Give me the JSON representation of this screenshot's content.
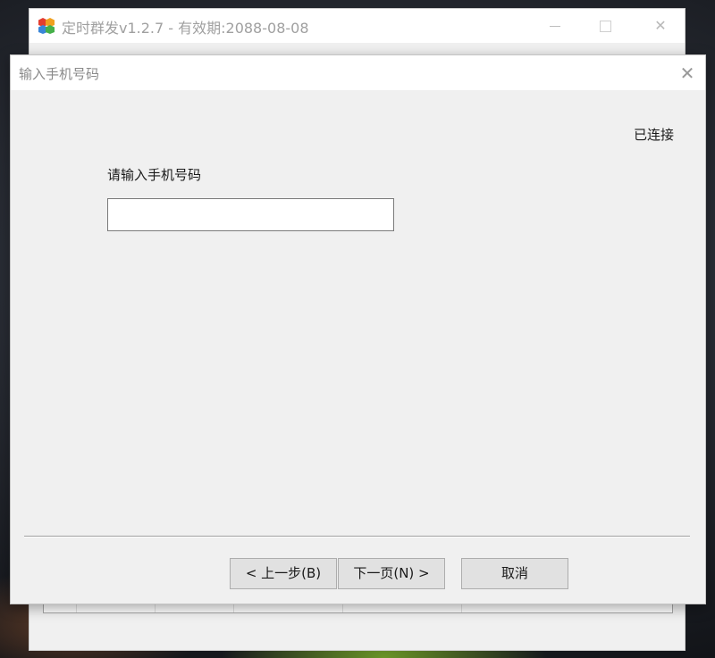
{
  "main_window": {
    "title": "定时群发v1.2.7 - 有效期:2088-08-08",
    "icon": "app-cubes-icon",
    "controls": {
      "minimize": "minimize-icon",
      "maximize": "maximize-icon",
      "close": "✕"
    }
  },
  "dialog": {
    "title": "输入手机号码",
    "close_glyph": "✕",
    "status": "已连接",
    "phone": {
      "label": "请输入手机号码",
      "value": "",
      "placeholder": ""
    },
    "buttons": {
      "prev": "< 上一步(B)",
      "next": "下一页(N) >",
      "cancel": "取消"
    }
  },
  "colors": {
    "window_bg": "#f0f0f0",
    "titlebar_bg": "#ffffff",
    "button_bg": "#e1e1e1",
    "button_border": "#adadad"
  }
}
